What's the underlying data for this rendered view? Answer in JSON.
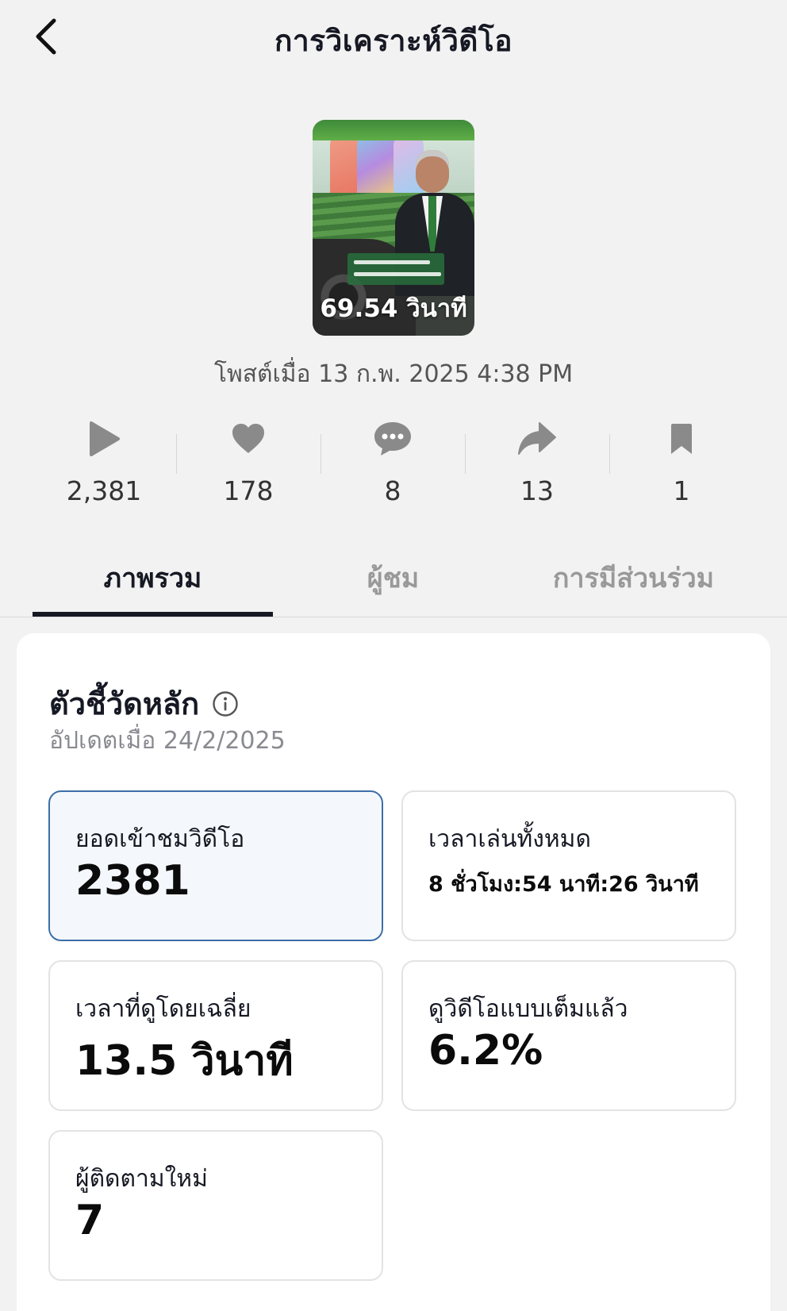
{
  "header": {
    "title": "การวิเคราะห์วิดีโอ"
  },
  "video": {
    "duration": "69.54 วินาที",
    "posted": "โพสต์เมื่อ 13 ก.พ. 2025 4:38 PM"
  },
  "stats": [
    {
      "icon": "play-icon",
      "value": "2,381"
    },
    {
      "icon": "heart-icon",
      "value": "178"
    },
    {
      "icon": "comment-icon",
      "value": "8"
    },
    {
      "icon": "share-icon",
      "value": "13"
    },
    {
      "icon": "bookmark-icon",
      "value": "1"
    }
  ],
  "tabs": [
    {
      "label": "ภาพรวม",
      "active": true
    },
    {
      "label": "ผู้ชม",
      "active": false
    },
    {
      "label": "การมีส่วนร่วม",
      "active": false
    }
  ],
  "key_metrics": {
    "title": "ตัวชี้วัดหลัก",
    "updated": "อัปเดตเมื่อ 24/2/2025",
    "items": [
      {
        "label": "ยอดเข้าชมวิดีโอ",
        "value": "2381"
      },
      {
        "label": "เวลาเล่นทั้งหมด",
        "value": "8 ชั่วโมง:54 นาที:26 วินาที"
      },
      {
        "label": "เวลาที่ดูโดยเฉลี่ย",
        "value": "13.5 วินาที"
      },
      {
        "label": "ดูวิดีโอแบบเต็มแล้ว",
        "value": "6.2%"
      },
      {
        "label": "ผู้ติดตามใหม่",
        "value": "7"
      }
    ]
  },
  "colors": {
    "selected_border": "#3d6ea8",
    "selected_bg": "#f4f8fc",
    "icon_gray": "#8a8a8a"
  }
}
